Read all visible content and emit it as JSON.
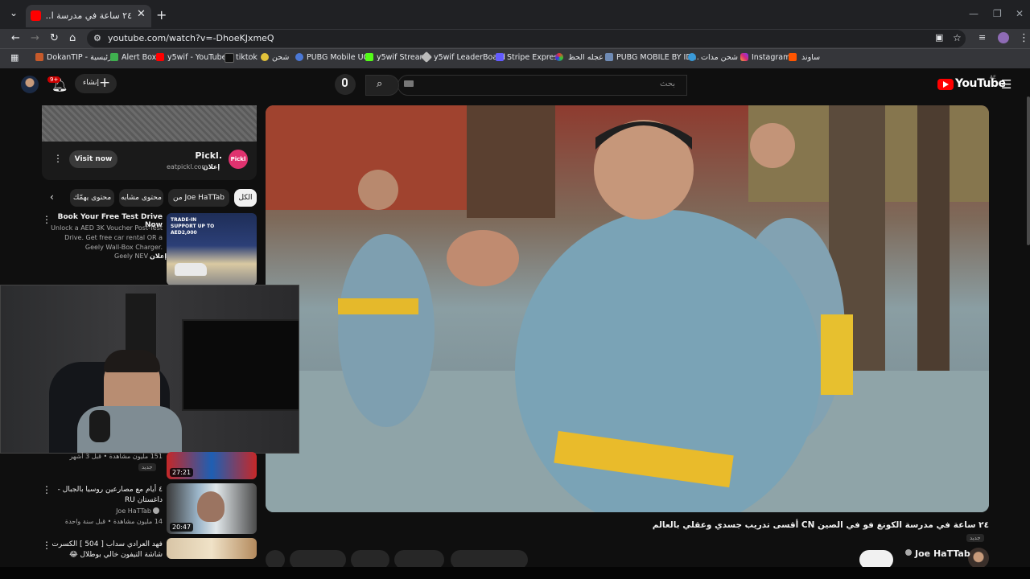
{
  "browser": {
    "tab_title": "٢٤ ساعة في مدرسة ا...(2401)",
    "url": "youtube.com/watch?v=-DhoeKJxmeQ",
    "bookmarks": [
      "DokanTIP - الرئيسية",
      "Alert Box",
      "y5wif - YouTube",
      "tiktok",
      "شحن",
      "PUBG Mobile UC",
      "y5wif Stream",
      "y5wif LeaderBoard",
      "Stripe Express",
      "عجله الحظ",
      "PUBG MOBILE BY ID...",
      "شحن مدات",
      "Instagram",
      "ساوند"
    ]
  },
  "youtube": {
    "logo_text": "YouTube",
    "logo_region": "AE",
    "search_placeholder": "بحث",
    "create_label": "إنشاء",
    "notif_count": "9+"
  },
  "ad": {
    "brand": "Pickl.",
    "brand_logo_text": "Pickl",
    "site": "eatpickl.com",
    "ad_label": "إعلان",
    "visit_label": "Visit now"
  },
  "chips": [
    "الكل",
    "من Joe HaTTab",
    "محتوى مشابه",
    "محتوى يهمّك"
  ],
  "sidebar": {
    "promo": {
      "title": "Book Your Free Test Drive Now",
      "desc": "Unlock a AED 3K Voucher Post-Test Drive. Get free car rental OR a Geely Wall-Box Charger.",
      "ad_label": "إعلان",
      "advertiser": "Geely NEV",
      "thumb_text": "TRADE-IN SUPPORT UP TO AED2,000"
    },
    "videos": [
      {
        "meta": "151 مليون مشاهدة • قبل 3 أشهر",
        "badge": "جديد",
        "duration": "27:21"
      },
      {
        "title": "٤ أيام مع مصارعين روسيا بالجبال - داغستان RU",
        "channel": "Joe HaTTab",
        "meta": "14 مليون مشاهدة • قبل سنة واحدة",
        "duration": "20:47"
      },
      {
        "title": "فهد العرادي سداب [ 504 ] الكسرت شاشة التيفون خالي بوطلال 😂",
        "duration": ""
      }
    ]
  },
  "video": {
    "title": "٢٤ ساعة في مدرسة الكونغ فو في الصين CN أقسى تدريب جسدي وعقلي بالعالم",
    "tag": "جديد",
    "channel": "Joe HaTTab"
  }
}
